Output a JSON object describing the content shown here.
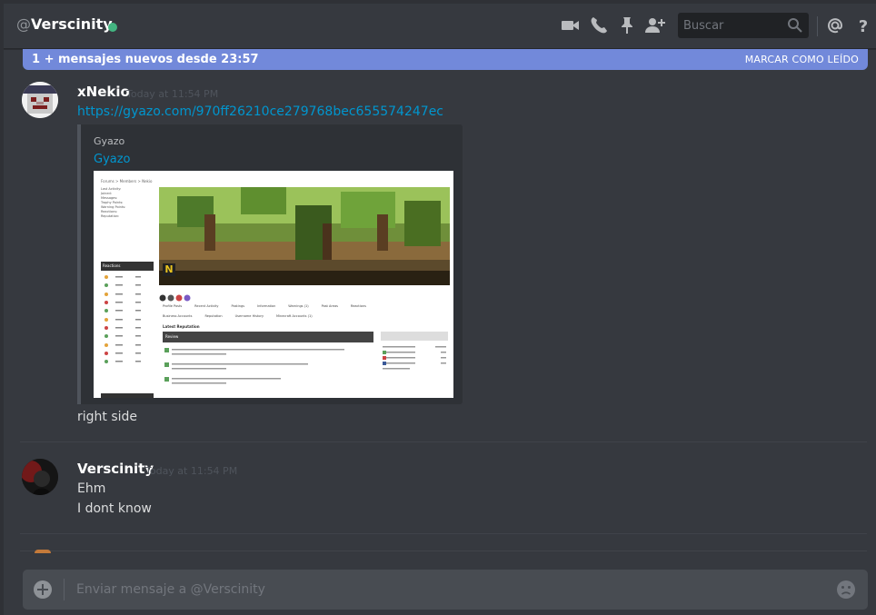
{
  "header": {
    "at_symbol": "@",
    "channel_name": "Verscinity",
    "status_color": "#43b581",
    "icons": [
      "video-call-icon",
      "voice-call-icon",
      "pin-icon",
      "add-friend-icon",
      "mention-icon",
      "help-icon"
    ],
    "search_placeholder": "Buscar"
  },
  "new_messages_bar": {
    "text": "1 + mensajes nuevos desde 23:57",
    "mark_read": "MARCAR COMO LEÍDO",
    "color": "#7289da"
  },
  "messages": [
    {
      "author": "xNekio",
      "timestamp": "Today at 11:54 PM",
      "link": "https://gyazo.com/970ff26210ce279768bec655574247ec",
      "embed": {
        "provider": "Gyazo",
        "title": "Gyazo",
        "screenshot": {
          "breadcrumb": "Forums > Members > Nekio",
          "stats": [
            [
              "Last Activity:",
              "1 minute ago"
            ],
            [
              "Joined:",
              "Aug 31, 2014"
            ],
            [
              "Messages:",
              "600"
            ],
            [
              "Trophy Points:",
              "130"
            ],
            [
              "Warning Points:",
              "0"
            ],
            [
              "Reactions:",
              "0"
            ],
            [
              "Reputation:",
              "361"
            ]
          ],
          "sidebar_title": "Reactions",
          "profile_initial": "N",
          "tabs_row1": [
            "Profile Posts",
            "Recent Activity",
            "Postings",
            "Information",
            "Warnings (1)",
            "Post Areas",
            "Reactions"
          ],
          "tabs_row2": [
            "Business Accounts",
            "Reputation",
            "Username History",
            "Minecraft Accounts (1)"
          ],
          "latest_rep": "Latest Reputation",
          "review": "Review"
        }
      },
      "text": "right side"
    },
    {
      "author": "Verscinity",
      "timestamp": "Today at 11:54 PM",
      "lines": [
        "Ehm",
        "I dont know"
      ]
    }
  ],
  "composer": {
    "placeholder": "Enviar mensaje a @Verscinity"
  }
}
